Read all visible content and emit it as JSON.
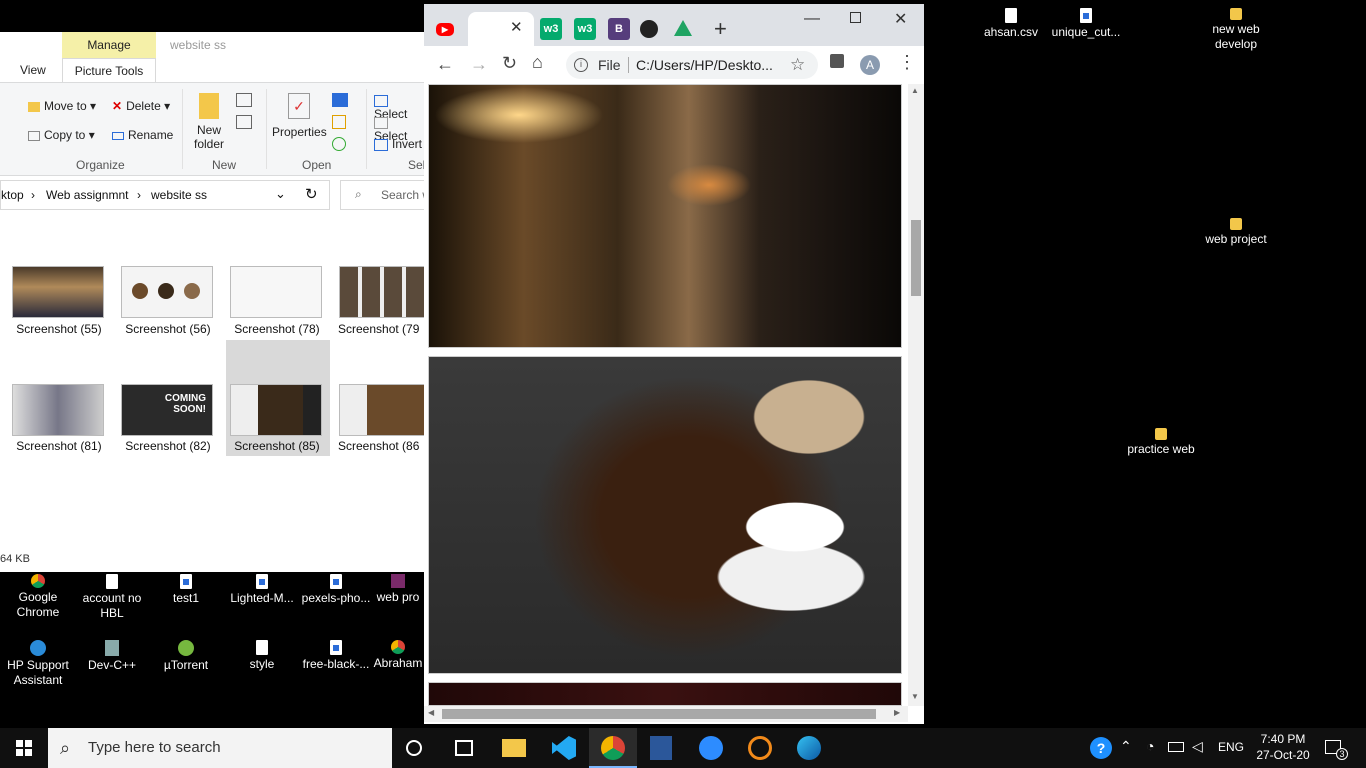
{
  "explorer": {
    "context_tab": "Manage",
    "context_sub": "Picture Tools",
    "window_title": "website ss",
    "tab_view": "View",
    "organize": {
      "move_to": "Move to",
      "copy_to": "Copy to",
      "delete": "Delete",
      "rename": "Rename",
      "group": "Organize"
    },
    "new": {
      "new_folder_1": "New",
      "new_folder_2": "folder",
      "group": "New"
    },
    "open": {
      "properties": "Properties",
      "group": "Open"
    },
    "select": {
      "select_all": "Select",
      "select_none": "Select",
      "invert": "Invert",
      "group": "Sel"
    },
    "address": {
      "seg1": "ktop",
      "seg2": "Web assignmnt",
      "seg3": "website ss"
    },
    "search_placeholder": "Search w",
    "files": [
      "Screenshot (55)",
      "Screenshot (56)",
      "Screenshot (78)",
      "Screenshot (79",
      "Screenshot (81)",
      "Screenshot (82)",
      "Screenshot (85)",
      "Screenshot (86"
    ],
    "status": "64 KB"
  },
  "desktop_left": [
    {
      "l1": "Google",
      "l2": "Chrome"
    },
    {
      "l1": "account no",
      "l2": "HBL"
    },
    {
      "l1": "test1",
      "l2": ""
    },
    {
      "l1": "Lighted-M...",
      "l2": ""
    },
    {
      "l1": "pexels-pho...",
      "l2": ""
    },
    {
      "l1": "web pro",
      "l2": ""
    },
    {
      "l1": "HP Support",
      "l2": "Assistant"
    },
    {
      "l1": "Dev-C++",
      "l2": ""
    },
    {
      "l1": "µTorrent",
      "l2": ""
    },
    {
      "l1": "style",
      "l2": ""
    },
    {
      "l1": "free-black-...",
      "l2": ""
    },
    {
      "l1": "Abraham",
      "l2": ""
    }
  ],
  "desktop_right": [
    {
      "l1": "ahsan.csv",
      "l2": ""
    },
    {
      "l1": "unique_cut...",
      "l2": ""
    },
    {
      "l1": "new web",
      "l2": "develop"
    },
    {
      "l1": "web project",
      "l2": ""
    },
    {
      "l1": "practice web",
      "l2": ""
    }
  ],
  "chrome": {
    "url_prefix": "File",
    "url": "C:/Users/HP/Deskto...",
    "profile_initial": "A",
    "tab_letters": {
      "bootstrap": "B",
      "w3a": "w3",
      "w3b": "w3"
    }
  },
  "taskbar": {
    "search_text": "Type here to search",
    "lang": "ENG",
    "time": "7:40 PM",
    "date": "27-Oct-20",
    "notif_count": "3"
  },
  "colors": {
    "accent": "#0078d7",
    "manage_tab": "#f5f0a8",
    "youtube": "#ff0000",
    "w3": "#04aa6d",
    "bootstrap": "#563d7c"
  }
}
